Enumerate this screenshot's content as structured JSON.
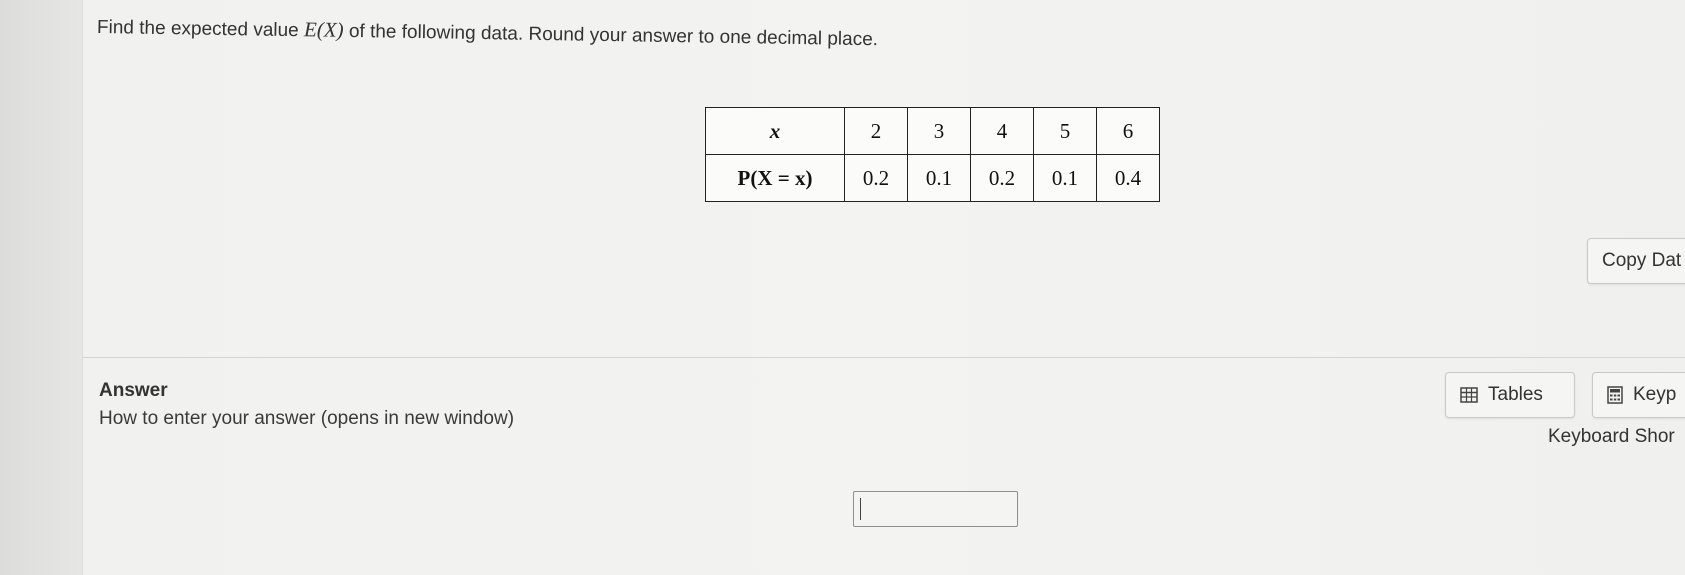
{
  "question": {
    "prefix": "Find the expected value ",
    "math": "E(X)",
    "suffix": " of the following data. Round your answer to one decimal place."
  },
  "table": {
    "row_headers": [
      "x",
      "P(X = x)"
    ],
    "x_values": [
      "2",
      "3",
      "4",
      "5",
      "6"
    ],
    "p_values": [
      "0.2",
      "0.1",
      "0.2",
      "0.1",
      "0.4"
    ]
  },
  "buttons": {
    "copy_data": "Copy Dat",
    "tables": "Tables",
    "keypad": "Keyp"
  },
  "answer": {
    "title": "Answer",
    "help_link": "How to enter your answer (opens in new window)",
    "keyboard_shortcuts": "Keyboard Shor",
    "input_value": ""
  },
  "icons": {
    "tables": "table-icon",
    "keypad": "calculator-icon"
  }
}
